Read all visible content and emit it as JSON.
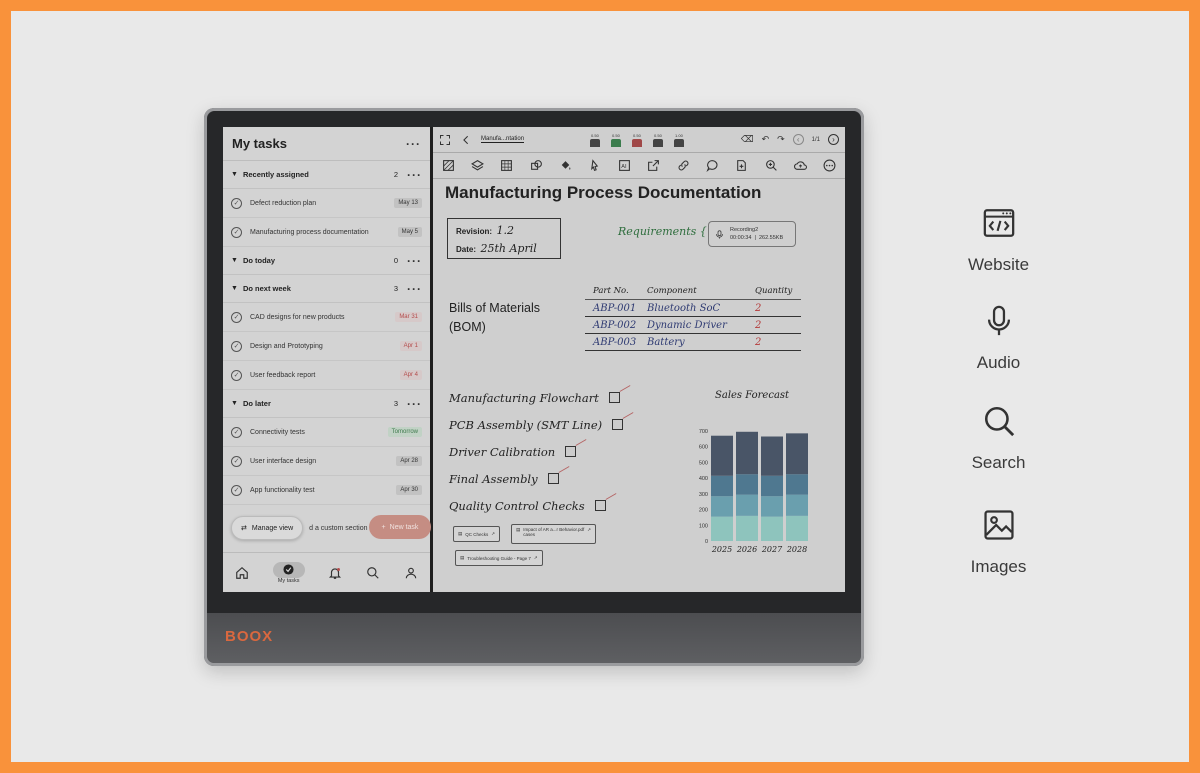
{
  "device": {
    "brand": "BOOX"
  },
  "tasks": {
    "title": "My tasks",
    "more": "···",
    "sections": [
      {
        "name": "Recently assigned",
        "count": "2",
        "items": [
          {
            "name": "Defect reduction plan",
            "date": "May 13",
            "style": "normal"
          },
          {
            "name": "Manufacturing process documentation",
            "date": "May 5",
            "style": "normal"
          }
        ]
      },
      {
        "name": "Do today",
        "count": "0",
        "items": []
      },
      {
        "name": "Do next week",
        "count": "3",
        "items": [
          {
            "name": "CAD designs for new products",
            "date": "Mar 31",
            "style": "red"
          },
          {
            "name": "Design and Prototyping",
            "date": "Apr 1",
            "style": "red"
          },
          {
            "name": "User feedback report",
            "date": "Apr 4",
            "style": "red"
          }
        ]
      },
      {
        "name": "Do later",
        "count": "3",
        "items": [
          {
            "name": "Connectivity tests",
            "date": "Tomorrow",
            "style": "green"
          },
          {
            "name": "User interface design",
            "date": "Apr 28",
            "style": "normal"
          },
          {
            "name": "App functionality test",
            "date": "Apr 30",
            "style": "normal"
          }
        ]
      }
    ],
    "manage_view": "Manage view",
    "add_section": "d a custom section",
    "new_task": "New task",
    "nav": {
      "my_tasks": "My tasks"
    }
  },
  "doc": {
    "breadcrumb": "Manufa...ntation",
    "page_indicator": "1/1",
    "title": "Manufacturing Process Documentation",
    "revision_label": "Revision:",
    "revision_value": "1.2",
    "date_label": "Date:",
    "date_value": "25th April",
    "requirements": "Requirements {",
    "recording": {
      "name": "Recording2",
      "duration": "00:00:34",
      "size": "262.55KB"
    },
    "bom_label_1": "Bills of Materials",
    "bom_label_2": "(BOM)",
    "bom_headers": [
      "Part No.",
      "Component",
      "Quantity"
    ],
    "bom_rows": [
      [
        "ABP-001",
        "Bluetooth SoC",
        "2"
      ],
      [
        "ABP-002",
        "Dynamic Driver",
        "2"
      ],
      [
        "ABP-003",
        "Battery",
        "2"
      ]
    ],
    "checklist": [
      "Manufacturing Flowchart",
      "PCB Assembly (SMT Line)",
      "Driver Calibration",
      "Final Assembly",
      "Quality Control Checks"
    ],
    "links": [
      "QC Checks",
      "Impact of AR a...r Behavior.pdf",
      "Troubleshooting Guide - Page 7"
    ],
    "links_sub": "cases"
  },
  "chart_data": {
    "type": "bar",
    "title": "Sales Forecast",
    "categories": [
      "2025",
      "2026",
      "2027",
      "2028"
    ],
    "series": [
      {
        "values": [
          155,
          160,
          155,
          160
        ]
      },
      {
        "values": [
          130,
          135,
          130,
          135
        ]
      },
      {
        "values": [
          130,
          130,
          130,
          130
        ]
      },
      {
        "values": [
          255,
          270,
          250,
          260
        ]
      }
    ],
    "colors": [
      "#8ec4bd",
      "#6a9fae",
      "#4f7890",
      "#495567"
    ],
    "ylim": [
      0,
      700
    ],
    "yticks": [
      "0",
      "100",
      "200",
      "300",
      "400",
      "500",
      "600",
      "700"
    ]
  },
  "features": [
    {
      "label": "Website",
      "icon": "code-window-icon"
    },
    {
      "label": "Audio",
      "icon": "microphone-icon"
    },
    {
      "label": "Search",
      "icon": "search-icon"
    },
    {
      "label": "Images",
      "icon": "image-icon"
    }
  ]
}
